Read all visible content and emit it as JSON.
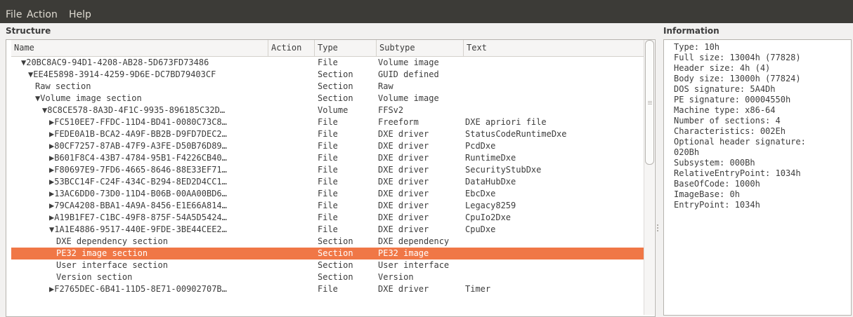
{
  "menu": [
    "File",
    "Action",
    "Help"
  ],
  "structure": {
    "title": "Structure",
    "columns": [
      "Name",
      "Action",
      "Type",
      "Subtype",
      "Text"
    ],
    "rows": [
      {
        "name": "▼20BC8AC9-94D1-4208-AB28-5D673FD73486",
        "type": "File",
        "subtype": "Volume image",
        "text": "",
        "indent": 1
      },
      {
        "name": "▼EE4E5898-3914-4259-9D6E-DC7BD79403CF",
        "type": "Section",
        "subtype": "GUID defined",
        "text": "",
        "indent": 2
      },
      {
        "name": "Raw section",
        "type": "Section",
        "subtype": "Raw",
        "text": "",
        "indent": 3
      },
      {
        "name": "▼Volume image section",
        "type": "Section",
        "subtype": "Volume image",
        "text": "",
        "indent": 3
      },
      {
        "name": "▼8C8CE578-8A3D-4F1C-9935-896185C32D…",
        "type": "Volume",
        "subtype": "FFSv2",
        "text": "",
        "indent": 4
      },
      {
        "name": "▶FC510EE7-FFDC-11D4-BD41-0080C73C8…",
        "type": "File",
        "subtype": "Freeform",
        "text": "DXE apriori file",
        "indent": 5
      },
      {
        "name": "▶FEDE0A1B-BCA2-4A9F-BB2B-D9FD7DEC2…",
        "type": "File",
        "subtype": "DXE driver",
        "text": "StatusCodeRuntimeDxe",
        "indent": 5
      },
      {
        "name": "▶80CF7257-87AB-47F9-A3FE-D50B76D89…",
        "type": "File",
        "subtype": "DXE driver",
        "text": "PcdDxe",
        "indent": 5
      },
      {
        "name": "▶B601F8C4-43B7-4784-95B1-F4226CB40…",
        "type": "File",
        "subtype": "DXE driver",
        "text": "RuntimeDxe",
        "indent": 5
      },
      {
        "name": "▶F80697E9-7FD6-4665-8646-88E33EF71…",
        "type": "File",
        "subtype": "DXE driver",
        "text": "SecurityStubDxe",
        "indent": 5
      },
      {
        "name": "▶53BCC14F-C24F-434C-B294-8ED2D4CC1…",
        "type": "File",
        "subtype": "DXE driver",
        "text": "DataHubDxe",
        "indent": 5
      },
      {
        "name": "▶13AC6DD0-73D0-11D4-B06B-00AA00BD6…",
        "type": "File",
        "subtype": "DXE driver",
        "text": "EbcDxe",
        "indent": 5
      },
      {
        "name": "▶79CA4208-BBA1-4A9A-8456-E1E66A814…",
        "type": "File",
        "subtype": "DXE driver",
        "text": "Legacy8259",
        "indent": 5
      },
      {
        "name": "▶A19B1FE7-C1BC-49F8-875F-54A5D5424…",
        "type": "File",
        "subtype": "DXE driver",
        "text": "CpuIo2Dxe",
        "indent": 5
      },
      {
        "name": "▼1A1E4886-9517-440E-9FDE-3BE44CEE2…",
        "type": "File",
        "subtype": "DXE driver",
        "text": "CpuDxe",
        "indent": 5
      },
      {
        "name": "DXE dependency section",
        "type": "Section",
        "subtype": "DXE dependency",
        "text": "",
        "indent": 6
      },
      {
        "name": "PE32 image section",
        "type": "Section",
        "subtype": "PE32 image",
        "text": "",
        "indent": 6,
        "selected": true
      },
      {
        "name": "User interface section",
        "type": "Section",
        "subtype": "User interface",
        "text": "",
        "indent": 6
      },
      {
        "name": "Version section",
        "type": "Section",
        "subtype": "Version",
        "text": "",
        "indent": 6
      },
      {
        "name": "▶F2765DEC-6B41-11D5-8E71-00902707B…",
        "type": "File",
        "subtype": "DXE driver",
        "text": "Timer",
        "indent": 5
      }
    ]
  },
  "information": {
    "title": "Information",
    "lines": [
      "Type: 10h",
      "Full size: 13004h (77828)",
      "Header size: 4h (4)",
      "Body size: 13000h (77824)",
      "DOS signature: 5A4Dh",
      "PE signature: 00004550h",
      "Machine type: x86-64",
      "Number of sections: 4",
      "Characteristics: 002Eh",
      "Optional header signature:",
      "020Bh",
      "Subsystem: 000Bh",
      "RelativeEntryPoint: 1034h",
      "BaseOfCode: 1000h",
      "ImageBase: 0h",
      "EntryPoint: 1034h"
    ]
  },
  "colors": {
    "menubar": "#3c3b37",
    "selection": "#f07746"
  }
}
